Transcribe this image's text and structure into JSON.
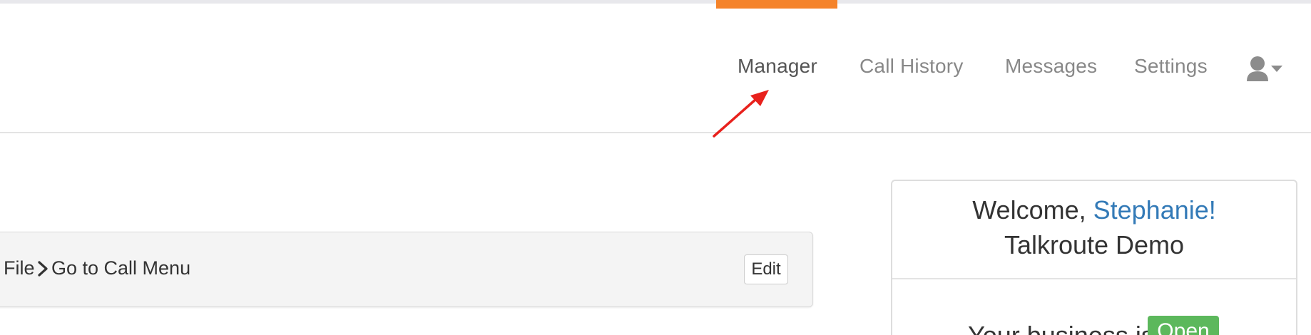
{
  "nav": {
    "items": [
      {
        "label": "Manager",
        "active": true
      },
      {
        "label": "Call History",
        "active": false
      },
      {
        "label": "Messages",
        "active": false
      },
      {
        "label": "Settings",
        "active": false
      }
    ],
    "user_menu_icon": "user-icon",
    "user_menu_caret_icon": "caret-down-icon",
    "active_color": "#f5832a"
  },
  "annotation": {
    "arrow_color": "#e8211c",
    "arrow_icon": "red-arrow-pointing-to-manager"
  },
  "breadcrumb": {
    "item_1": "File",
    "separator_icon": "chevron-right-icon",
    "item_2": "Go to Call Menu",
    "edit_label": "Edit"
  },
  "welcome": {
    "greeting": "Welcome, ",
    "user_name": "Stephanie!",
    "company": "Talkroute Demo",
    "status_text": "Your business is",
    "status_badge": "Open",
    "status_color": "#5cb85c",
    "name_color": "#337ab7"
  }
}
